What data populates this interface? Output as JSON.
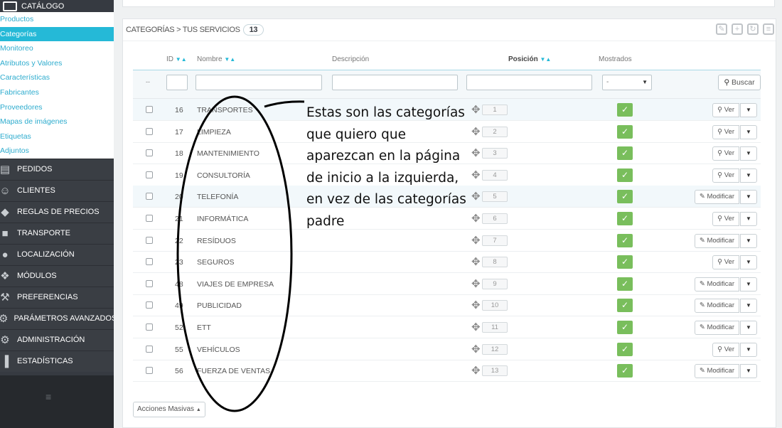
{
  "sidebar": {
    "catalog_label": "CATÁLOGO",
    "sub_items": [
      {
        "label": "Productos",
        "active": false
      },
      {
        "label": "Categorías",
        "active": true
      },
      {
        "label": "Monitoreo",
        "active": false
      },
      {
        "label": "Atributos y Valores",
        "active": false
      },
      {
        "label": "Características",
        "active": false
      },
      {
        "label": "Fabricantes",
        "active": false
      },
      {
        "label": "Proveedores",
        "active": false
      },
      {
        "label": "Mapas de imágenes",
        "active": false
      },
      {
        "label": "Etiquetas",
        "active": false
      },
      {
        "label": "Adjuntos",
        "active": false
      }
    ],
    "main_items": [
      {
        "label": "PEDIDOS",
        "icon": "orders-icon"
      },
      {
        "label": "CLIENTES",
        "icon": "customers-icon"
      },
      {
        "label": "REGLAS DE PRECIOS",
        "icon": "price-rules-icon"
      },
      {
        "label": "TRANSPORTE",
        "icon": "truck-icon"
      },
      {
        "label": "LOCALIZACIÓN",
        "icon": "globe-icon"
      },
      {
        "label": "MÓDULOS",
        "icon": "puzzle-icon"
      },
      {
        "label": "PREFERENCIAS",
        "icon": "wrench-icon"
      },
      {
        "label": "PARÁMETROS AVANZADOS",
        "icon": "gears-icon"
      },
      {
        "label": "ADMINISTRACIÓN",
        "icon": "gear-icon"
      },
      {
        "label": "ESTADÍSTICAS",
        "icon": "bar-chart-icon"
      }
    ],
    "bottom_icon": "menu-collapse-icon"
  },
  "panel": {
    "title": "CATEGORÍAS > TUS SERVICIOS",
    "count": "13",
    "columns": {
      "id": "ID",
      "name": "Nombre",
      "description": "Descripción",
      "position": "Posición",
      "shown": "Mostrados"
    },
    "filter": {
      "dash": "--",
      "shown_select": "-",
      "search_button": "Buscar"
    },
    "rows": [
      {
        "id": "16",
        "name": "TRANSPORTES",
        "position": "1",
        "action": "Ver"
      },
      {
        "id": "17",
        "name": "LIMPIEZA",
        "position": "2",
        "action": "Ver"
      },
      {
        "id": "18",
        "name": "MANTENIMIENTO",
        "position": "3",
        "action": "Ver"
      },
      {
        "id": "19",
        "name": "CONSULTORÍA",
        "position": "4",
        "action": "Ver"
      },
      {
        "id": "20",
        "name": "TELEFONÍA",
        "position": "5",
        "action": "Modificar"
      },
      {
        "id": "21",
        "name": "INFORMÁTICA",
        "position": "6",
        "action": "Ver"
      },
      {
        "id": "22",
        "name": "RESÍDUOS",
        "position": "7",
        "action": "Modificar"
      },
      {
        "id": "23",
        "name": "SEGUROS",
        "position": "8",
        "action": "Ver"
      },
      {
        "id": "48",
        "name": "VIAJES DE EMPRESA",
        "position": "9",
        "action": "Modificar"
      },
      {
        "id": "49",
        "name": "PUBLICIDAD",
        "position": "10",
        "action": "Modificar"
      },
      {
        "id": "52",
        "name": "ETT",
        "position": "11",
        "action": "Modificar"
      },
      {
        "id": "55",
        "name": "VEHÍCULOS",
        "position": "12",
        "action": "Ver"
      },
      {
        "id": "56",
        "name": "FUERZA DE VENTAS",
        "position": "13",
        "action": "Modificar"
      }
    ],
    "bulk_actions": "Acciones Masivas"
  },
  "annotation": {
    "lines": [
      "Estas son las categorías",
      "que quiero que",
      "aparezcan en la  página",
      "de inicio a la izquierda,",
      "en vez de las categorías",
      "padre"
    ]
  },
  "colors": {
    "accent": "#25b9d7",
    "sidebar_bg": "#363a41",
    "shown_green": "#79be5c"
  }
}
